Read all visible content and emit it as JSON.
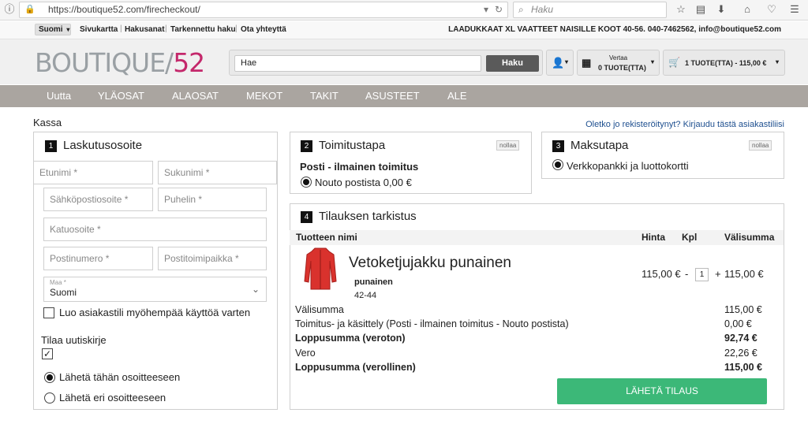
{
  "browser": {
    "url": "https://boutique52.com/firecheckout/",
    "search_placeholder": "Haku"
  },
  "topbar": {
    "language": "Suomi",
    "links": [
      "Sivukartta",
      "Hakusanat",
      "Tarkennettu haku",
      "Ota yhteyttä"
    ],
    "contact": "LAADUKKAAT XL VAATTEET NAISILLE KOOT 40-56. 040-7462562, info@boutique52.com"
  },
  "header": {
    "logo_part1": "BOUTIQUE/",
    "logo_part2": "52",
    "search_value": "Hae",
    "search_button": "Haku",
    "compare_label": "Vertaa",
    "compare_count": "0 TUOTE(TTA)",
    "cart_label": "1 TUOTE(TTA) - 115,00 €"
  },
  "nav": [
    "Uutta",
    "YLÄOSAT",
    "ALAOSAT",
    "MEKOT",
    "TAKIT",
    "ASUSTEET",
    "ALE"
  ],
  "page": {
    "title": "Kassa",
    "login_link": "Oletko jo rekisteröitynyt? Kirjaudu tästä asiakastiliisi"
  },
  "billing": {
    "num": "1",
    "title": "Laskutusosoite",
    "fields": {
      "firstname": "Etunimi *",
      "lastname": "Sukunimi *",
      "email": "Sähköpostiosoite *",
      "phone": "Puhelin *",
      "street": "Katuosoite *",
      "postcode": "Postinumero *",
      "city": "Postitoimipaikka *"
    },
    "country_label": "Maa *",
    "country_value": "Suomi",
    "create_account": "Luo asiakastili myöhempää käyttöä varten",
    "newsletter": "Tilaa uutiskirje",
    "ship_same": "Lähetä tähän osoitteeseen",
    "ship_other": "Lähetä eri osoitteeseen"
  },
  "shipping": {
    "num": "2",
    "title": "Toimitustapa",
    "reset": "nollaa",
    "method_title": "Posti - ilmainen toimitus",
    "option": "Nouto postista 0,00 €"
  },
  "payment": {
    "num": "3",
    "title": "Maksutapa",
    "reset": "nollaa",
    "option": "Verkkopankki ja luottokortti"
  },
  "review": {
    "num": "4",
    "title": "Tilauksen tarkistus",
    "headers": {
      "name": "Tuotteen nimi",
      "price": "Hinta",
      "qty": "Kpl",
      "subtotal": "Välisumma"
    },
    "item": {
      "name": "Vetoketjujakku punainen",
      "color": "punainen",
      "size": "42-44",
      "price": "115,00 €",
      "minus": "-",
      "qty": "1",
      "plus": "+",
      "subtotal": "115,00 €"
    },
    "totals": [
      {
        "label": "Välisumma",
        "value": "115,00 €",
        "bold": false
      },
      {
        "label": "Toimitus- ja käsittely (Posti - ilmainen toimitus - Nouto postista)",
        "value": "0,00 €",
        "bold": false
      },
      {
        "label": "Loppusumma (veroton)",
        "value": "92,74 €",
        "bold": true
      },
      {
        "label": "Vero",
        "value": "22,26 €",
        "bold": false
      },
      {
        "label": "Loppusumma (verollinen)",
        "value": "115,00 €",
        "bold": true
      }
    ],
    "submit": "LÄHETÄ TILAUS"
  },
  "colors": {
    "nav_bg": "#aaa5a0",
    "logo_pink": "#c4286b",
    "submit_green": "#3cb878",
    "link_blue": "#1e4f8f",
    "product_red": "#d9322d"
  }
}
